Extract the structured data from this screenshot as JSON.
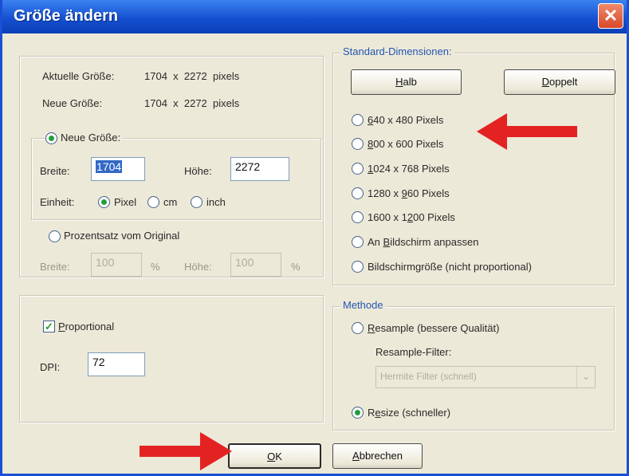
{
  "window": {
    "title": "Größe ändern",
    "close_glyph": "✕"
  },
  "size_info": {
    "current_label": "Aktuelle Größe:",
    "current_value": "1704  x  2272  pixels",
    "new_label": "Neue Größe:",
    "new_value": "1704  x  2272  pixels"
  },
  "new_size": {
    "label_pre": "",
    "label_u": "N",
    "label_post": "eue Größe:",
    "width_label": "Breite:",
    "width_value": "1704",
    "height_label": "Höhe:",
    "height_value": "2272",
    "unit_label": "Einheit:",
    "unit_pixel": "Pixel",
    "unit_cm": "cm",
    "unit_inch": "inch",
    "unit_selected": "Pixel"
  },
  "percent": {
    "label": "Prozentsatz vom Original",
    "width_label": "Breite:",
    "width_value": "100",
    "width_unit": "%",
    "height_label": "Höhe:",
    "height_value": "100",
    "height_unit": "%"
  },
  "proportional": {
    "label_u": "P",
    "label_post": "roportional",
    "checked": true,
    "check_glyph": "✓"
  },
  "dpi": {
    "label": "DPI:",
    "value": "72"
  },
  "standard_dimensions": {
    "legend": "Standard-Dimensionen:",
    "half_u": "H",
    "half_post": "alb",
    "double_u": "D",
    "double_post": "oppelt",
    "options": [
      {
        "u": "6",
        "post": "40 x 480 Pixels"
      },
      {
        "u": "8",
        "post": "00 x 600 Pixels"
      },
      {
        "u": "1",
        "post": "024 x 768 Pixels"
      },
      {
        "pre": "1280 x ",
        "u": "9",
        "post": "60 Pixels"
      },
      {
        "pre": "1600 x 1",
        "u": "2",
        "post": "00 Pixels"
      },
      {
        "pre": "An ",
        "u": "B",
        "post": "ildschirm anpassen"
      },
      {
        "pre": "Bildschirm",
        "u": "g",
        "post": "röße (nicht proportional)"
      }
    ]
  },
  "method": {
    "legend": "Methode",
    "resample_u": "R",
    "resample_post": "esample (bessere Qualität)",
    "filter_label": "Resample-Filter:",
    "filter_value": "Hermite Filter (schnell)",
    "resize_pre": "R",
    "resize_u": "e",
    "resize_post": "size (schneller)",
    "selected": "Resize (schneller)"
  },
  "buttons": {
    "ok_u": "O",
    "ok_post": "K",
    "cancel_u": "A",
    "cancel_post": "bbrechen"
  },
  "colors": {
    "title_bar": "#1550d0",
    "arrow": "#e32222",
    "accent": "#2456b3"
  }
}
